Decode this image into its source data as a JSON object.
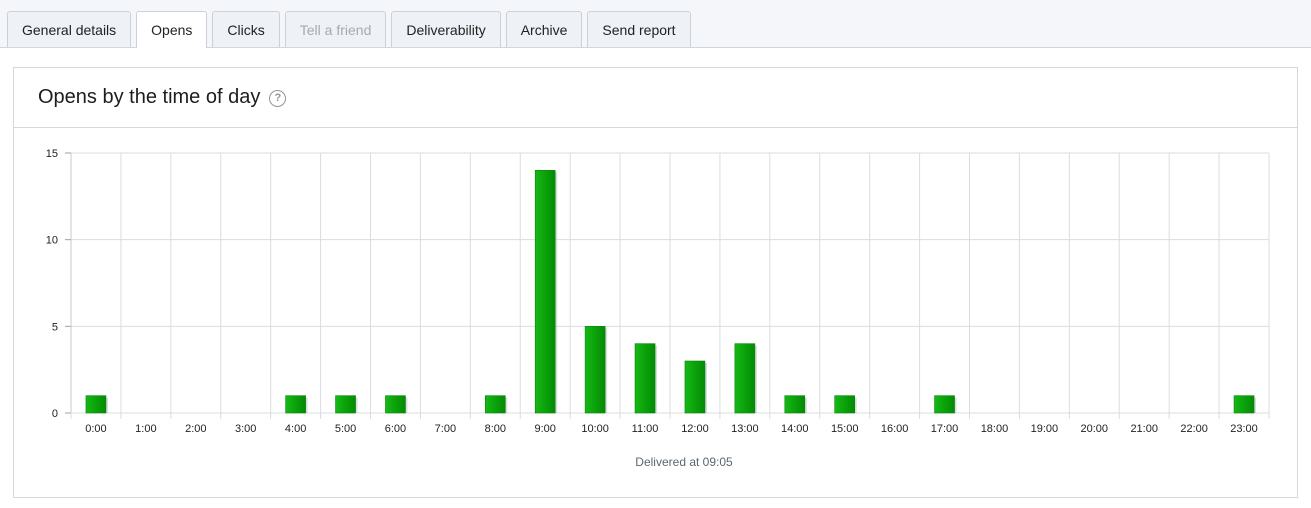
{
  "tabs": [
    {
      "label": "General details",
      "state": "normal"
    },
    {
      "label": "Opens",
      "state": "active"
    },
    {
      "label": "Clicks",
      "state": "normal"
    },
    {
      "label": "Tell a friend",
      "state": "disabled"
    },
    {
      "label": "Deliverability",
      "state": "normal"
    },
    {
      "label": "Archive",
      "state": "normal"
    },
    {
      "label": "Send report",
      "state": "normal"
    }
  ],
  "panel": {
    "title": "Opens by the time of day",
    "help_icon": "question-circle-icon"
  },
  "chart_data": {
    "type": "bar",
    "categories": [
      "0:00",
      "1:00",
      "2:00",
      "3:00",
      "4:00",
      "5:00",
      "6:00",
      "7:00",
      "8:00",
      "9:00",
      "10:00",
      "11:00",
      "12:00",
      "13:00",
      "14:00",
      "15:00",
      "16:00",
      "17:00",
      "18:00",
      "19:00",
      "20:00",
      "21:00",
      "22:00",
      "23:00"
    ],
    "values": [
      1,
      0,
      0,
      0,
      1,
      1,
      1,
      0,
      1,
      14,
      5,
      4,
      3,
      4,
      1,
      1,
      0,
      1,
      0,
      0,
      0,
      0,
      0,
      1
    ],
    "ylim": [
      0,
      15
    ],
    "yticks": [
      0,
      5,
      10,
      15
    ],
    "grid": true,
    "bar_color": "#0aa20a",
    "footer": "Delivered at 09:05"
  }
}
